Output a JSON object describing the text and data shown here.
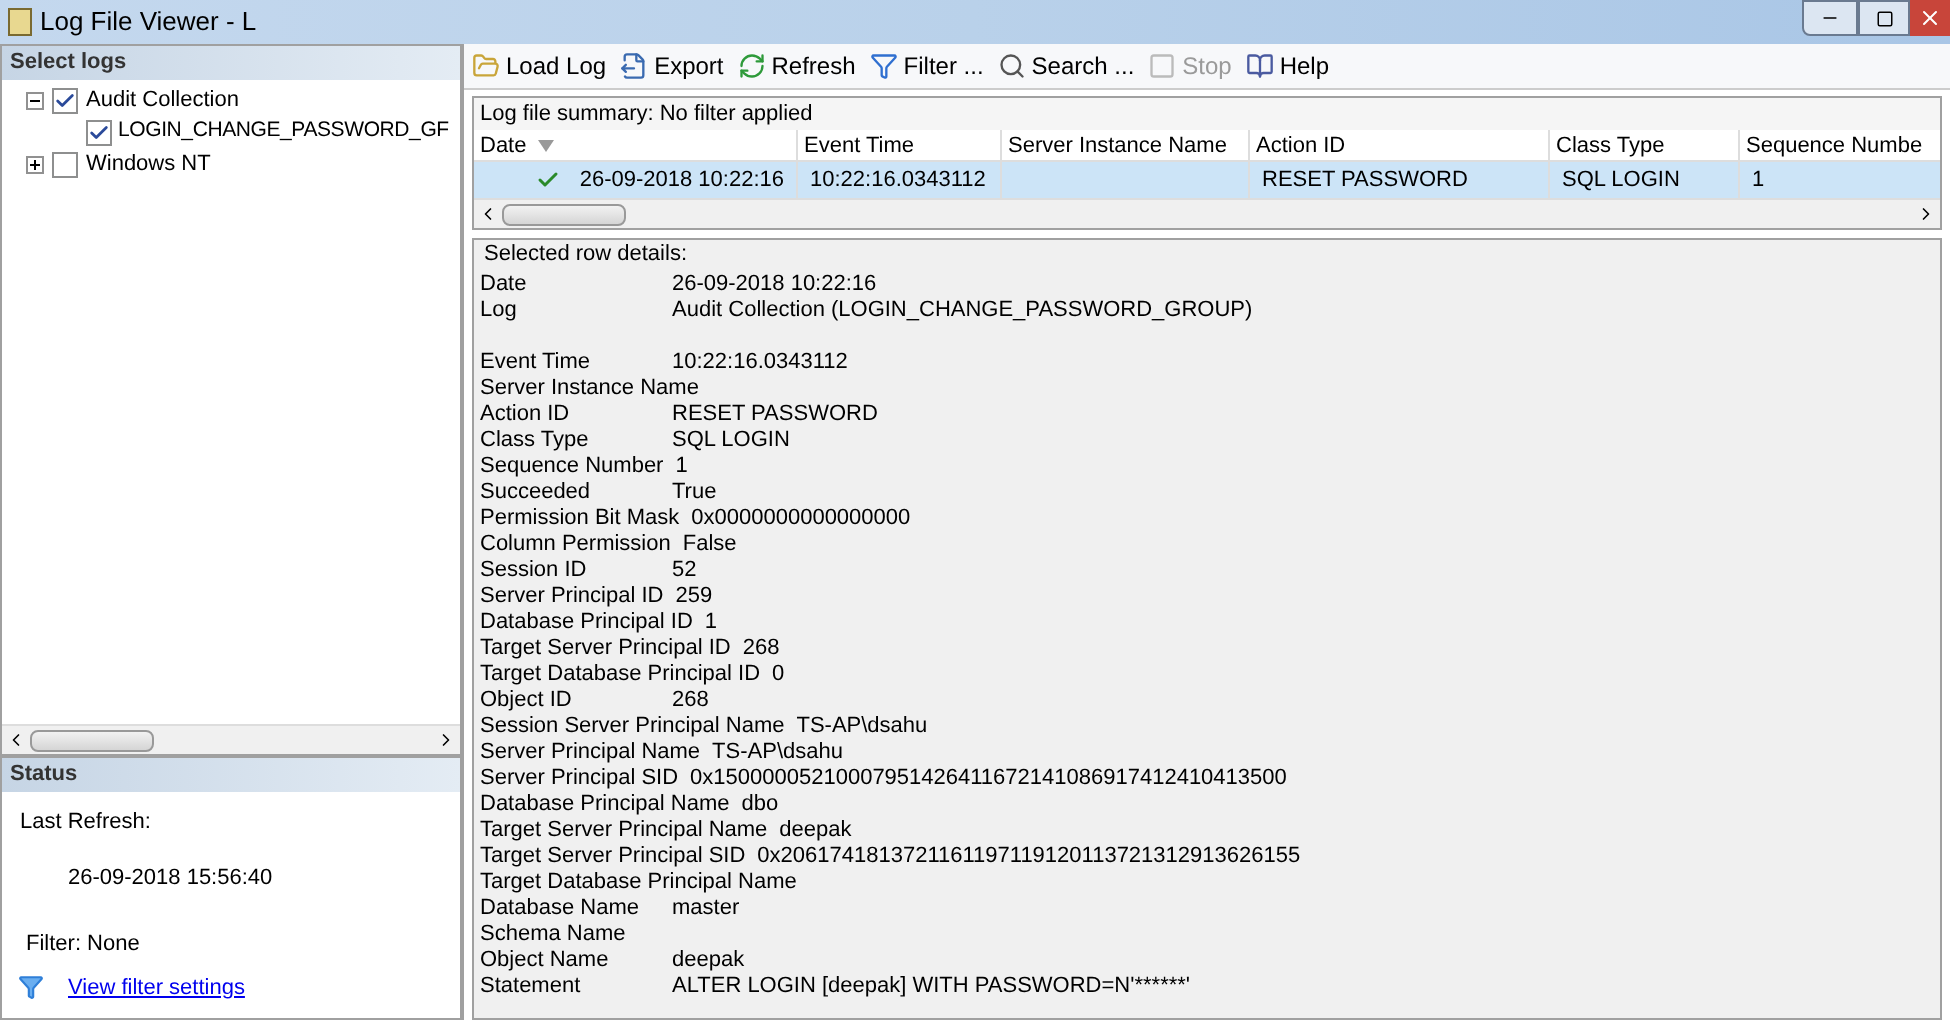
{
  "window": {
    "title": "Log File Viewer - L"
  },
  "select_logs": {
    "title": "Select logs",
    "tree": [
      {
        "label": "Audit Collection",
        "checked": true,
        "expanded": true,
        "children": [
          {
            "label": "LOGIN_CHANGE_PASSWORD_GF",
            "checked": true
          }
        ]
      },
      {
        "label": "Windows NT",
        "checked": false,
        "expanded": false
      }
    ]
  },
  "status": {
    "title": "Status",
    "last_refresh_label": "Last Refresh:",
    "last_refresh": "26-09-2018 15:56:40",
    "filter": "Filter: None",
    "link": "View filter settings"
  },
  "toolbar": [
    {
      "label": "Load Log",
      "kind": "folder",
      "disabled": false
    },
    {
      "label": "Export",
      "kind": "export",
      "disabled": false
    },
    {
      "label": "Refresh",
      "kind": "refresh",
      "disabled": false
    },
    {
      "label": "Filter ...",
      "kind": "filter",
      "disabled": false
    },
    {
      "label": "Search ...",
      "kind": "search",
      "disabled": false
    },
    {
      "label": "Stop",
      "kind": "stop",
      "disabled": true
    },
    {
      "label": "Help",
      "kind": "help",
      "disabled": false
    }
  ],
  "summary": "Log file summary: No filter applied",
  "table": {
    "columns": [
      "Date",
      "Event Time",
      "Server Instance Name",
      "Action ID",
      "Class Type",
      "Sequence Numbe"
    ],
    "rows": [
      {
        "selected": true,
        "cells": [
          "26-09-2018 10:22:16",
          "10:22:16.0343112",
          null,
          "RESET PASSWORD",
          "SQL LOGIN",
          "1"
        ]
      }
    ]
  },
  "details": {
    "title": "Selected row details:",
    "rows": [
      {
        "label": "Date",
        "value": "26-09-2018 10:22:16"
      },
      {
        "label": "Log",
        "value": "Audit Collection (LOGIN_CHANGE_PASSWORD_GROUP)"
      },
      {
        "label": "Event Time",
        "value": "10:22:16.0343112"
      },
      {
        "label": "Server Instance Name"
      },
      {
        "label": "Action ID",
        "value": "RESET PASSWORD"
      },
      {
        "label": "Class Type",
        "value": "SQL LOGIN"
      },
      {
        "label": "Sequence Number",
        "value": "1"
      },
      {
        "label": "Succeeded",
        "value": "True"
      },
      {
        "label": "Permission Bit Mask",
        "value": "0x0000000000000000"
      },
      {
        "label": "Column Permission",
        "value": "False"
      },
      {
        "label": "Session ID",
        "value": "52"
      },
      {
        "label": "Server Principal ID",
        "value": "259"
      },
      {
        "label": "Database Principal ID",
        "value": "1"
      },
      {
        "label": "Target Server Principal ID",
        "value": "268"
      },
      {
        "label": "Target Database Principal ID",
        "value": "0"
      },
      {
        "label": "Object ID",
        "value": "268"
      },
      {
        "label": "Session Server Principal Name",
        "value": "TS-AP\\dsahu"
      },
      {
        "label": "Server Principal Name",
        "value": "TS-AP\\dsahu"
      },
      {
        "label": "Server Principal SID",
        "value": "0x15000005210007951426411672141086917412410413500"
      },
      {
        "label": "Database Principal Name",
        "value": "dbo"
      },
      {
        "label": "Target Server Principal Name",
        "value": "deepak"
      },
      {
        "label": "Target Server Principal SID",
        "value": "0x2061741813721161197119120113721312913626155"
      },
      {
        "label": "Target Database Principal Name"
      },
      {
        "label": "Database Name",
        "value": "master"
      },
      {
        "label": "Schema Name"
      },
      {
        "label": "Object Name",
        "value": "deepak"
      },
      {
        "label": "Statement",
        "value": "ALTER LOGIN [deepak] WITH PASSWORD=N'******'"
      }
    ]
  }
}
